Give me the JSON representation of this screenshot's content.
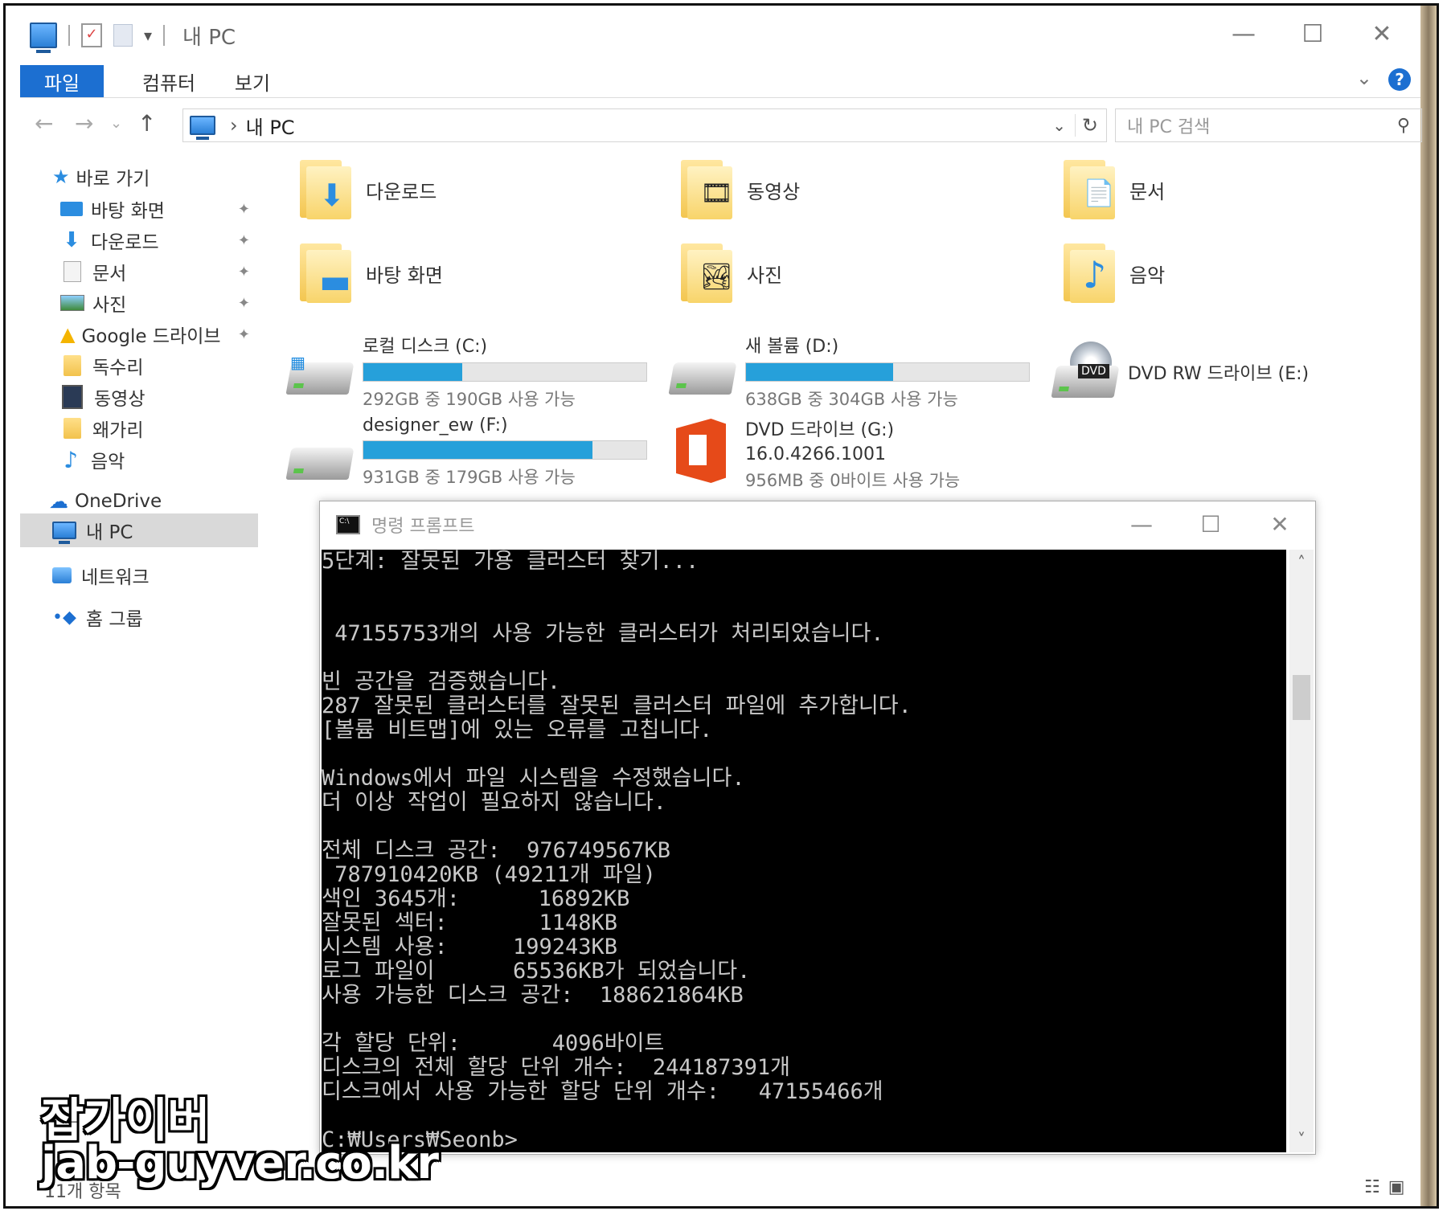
{
  "window": {
    "title": "내 PC",
    "minimize": "—",
    "maximize": "☐",
    "close": "✕"
  },
  "ribbon": {
    "tabs": [
      "파일",
      "컴퓨터",
      "보기"
    ],
    "help": "?"
  },
  "nav": {
    "back": "←",
    "forward": "→",
    "up": "↑",
    "breadcrumb_sep": "›",
    "location": "내 PC",
    "refresh": "↻",
    "search_placeholder": "내 PC 검색"
  },
  "sidebar": {
    "items": [
      {
        "label": "바로 가기",
        "icon": "star-icon",
        "pinned": false
      },
      {
        "label": "바탕 화면",
        "icon": "desktop-icon",
        "pinned": true
      },
      {
        "label": "다운로드",
        "icon": "download-icon",
        "pinned": true
      },
      {
        "label": "문서",
        "icon": "document-icon",
        "pinned": true
      },
      {
        "label": "사진",
        "icon": "picture-icon",
        "pinned": true
      },
      {
        "label": "Google 드라이브",
        "icon": "google-drive-icon",
        "pinned": true
      },
      {
        "label": "독수리",
        "icon": "folder-icon",
        "pinned": false
      },
      {
        "label": "동영상",
        "icon": "video-icon",
        "pinned": false
      },
      {
        "label": "왜가리",
        "icon": "folder-icon",
        "pinned": false
      },
      {
        "label": "음악",
        "icon": "music-icon",
        "pinned": false
      },
      {
        "label": "OneDrive",
        "icon": "onedrive-icon",
        "pinned": false
      },
      {
        "label": "내 PC",
        "icon": "pc-icon",
        "pinned": false,
        "selected": true
      },
      {
        "label": "네트워크",
        "icon": "network-icon",
        "pinned": false
      },
      {
        "label": "홈 그룹",
        "icon": "homegroup-icon",
        "pinned": false
      }
    ],
    "pin_glyph": "📌"
  },
  "folders": [
    {
      "label": "다운로드",
      "badge": "⬇"
    },
    {
      "label": "동영상",
      "badge": "🎞"
    },
    {
      "label": "문서",
      "badge": "📄"
    },
    {
      "label": "바탕 화면",
      "badge": "▬"
    },
    {
      "label": "사진",
      "badge": "🏞"
    },
    {
      "label": "음악",
      "badge": "♪"
    }
  ],
  "drives": [
    {
      "label": "로컬 디스크 (C:)",
      "free": "292GB 중 190GB 사용 가능",
      "used_fraction": 0.35
    },
    {
      "label": "새 볼륨 (D:)",
      "free": "638GB 중 304GB 사용 가능",
      "used_fraction": 0.52
    },
    {
      "label": "DVD RW 드라이브 (E:)",
      "badge": "DVD"
    },
    {
      "label": "designer_ew (F:)",
      "free": "931GB 중 179GB 사용 가능",
      "used_fraction": 0.81
    },
    {
      "label": "DVD 드라이브 (G:)",
      "line2": "16.0.4266.1001",
      "free": "956MB 중 0바이트 사용 가능"
    }
  ],
  "cmd": {
    "title": "명령 프롬프트",
    "lines": [
      "5단계: 잘못된 가용 클러스터 찾기...",
      "",
      "",
      " 47155753개의 사용 가능한 클러스터가 처리되었습니다.",
      "",
      "빈 공간을 검증했습니다.",
      "287 잘못된 클러스터를 잘못된 클러스터 파일에 추가합니다.",
      "[볼륨 비트맵]에 있는 오류를 고칩니다.",
      "",
      "Windows에서 파일 시스템을 수정했습니다.",
      "더 이상 작업이 필요하지 않습니다.",
      "",
      "전체 디스크 공간:  976749567KB",
      " 787910420KB (49211개 파일)",
      "색인 3645개:      16892KB",
      "잘못된 섹터:       1148KB",
      "시스템 사용:     199243KB",
      "로그 파일이      65536KB가 되었습니다.",
      "사용 가능한 디스크 공간:  188621864KB",
      "",
      "각 할당 단위:       4096바이트",
      "디스크의 전체 할당 단위 개수:  244187391개",
      "디스크에서 사용 가능한 할당 단위 개수:   47155466개",
      "",
      "C:₩Users₩Seonb>"
    ],
    "scroll_up": "˄",
    "scroll_down": "˅"
  },
  "status": {
    "count": "11개 항목"
  },
  "watermark": {
    "line1": "잡가이버",
    "line2": "jab-guyver.co.kr"
  }
}
